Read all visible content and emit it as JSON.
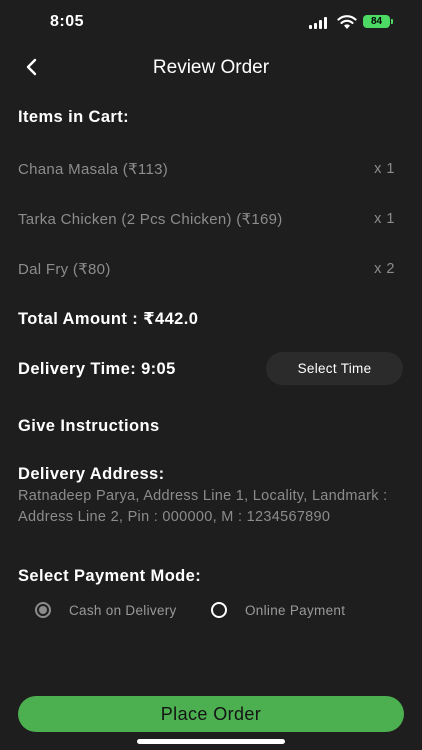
{
  "status_bar": {
    "time": "8:05",
    "battery": "84"
  },
  "header": {
    "title": "Review Order"
  },
  "cart": {
    "title": "Items in Cart:",
    "items": [
      {
        "name": "Chana Masala (₹113)",
        "qty": "x 1"
      },
      {
        "name": "Tarka Chicken (2 Pcs Chicken) (₹169)",
        "qty": "x 1"
      },
      {
        "name": "Dal Fry (₹80)",
        "qty": "x 2"
      }
    ]
  },
  "total": {
    "label": "Total Amount : ₹442.0"
  },
  "delivery_time": {
    "label": "Delivery Time: 9:05",
    "button": "Select Time"
  },
  "instructions": {
    "label": "Give Instructions"
  },
  "address": {
    "title": "Delivery Address:",
    "text": "Ratnadeep Parya, Address Line 1, Locality, Landmark : Address Line 2, Pin : 000000, M : 1234567890"
  },
  "payment": {
    "title": "Select Payment Mode:",
    "options": [
      {
        "label": "Cash on Delivery",
        "selected": true
      },
      {
        "label": "Online Payment",
        "selected": false
      }
    ]
  },
  "footer": {
    "place_order": "Place Order"
  },
  "colors": {
    "background": "#1e1e1e",
    "accent": "#4caf50",
    "battery": "#4cd964",
    "muted_text": "#8c8c8c"
  }
}
